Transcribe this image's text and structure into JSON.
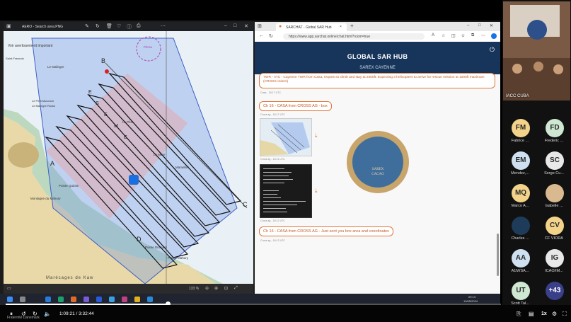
{
  "map_window": {
    "title": "AERO - Search area.PNG",
    "zoom": "133 %",
    "chart_labels": {
      "avertissement": "Voir avertissement important",
      "saint_francois": "Saint-Francois",
      "malingre": "Le Malingre",
      "petit_mouchoir": "Le Petit Mouchoir",
      "malingre_rocks": "Le Malingre Rocks",
      "pointe_quintin": "Pointe Quintin",
      "montagne": "Montagne du Mahury",
      "pointe_diamant": "Pointe Diamant",
      "marecages": "Marécages de Kaw",
      "letters": [
        "A",
        "B",
        "C",
        "D",
        "E",
        "S",
        "E",
        "M",
        "E"
      ],
      "perou": "Pérou",
      "pere": "Le Père",
      "mere": "La Mère",
      "mamelles": "Mamelles",
      "pointe_mahury": "Pointe Mahury"
    }
  },
  "browser": {
    "tab_title": "SARCHAT - Global SAR Hub",
    "url": "https://www.app.sarchat.online/chat.html?room=true"
  },
  "hub": {
    "title": "GLOBAL SAR HUB",
    "subtitle": "SAREX CAYENNE"
  },
  "chat": {
    "msg1_text": "TWR - ATC - Cayenne TWR from Casa, request to climb and stay at 2000ft. Expecting 3 helicopters to arrive for rescue mission at 1000ft maximum (CROSS orders)",
    "msg1_meta": "Casa - 18:17 UTC",
    "msg2_text": "Ch 16 - CASA from CROSS AG - box",
    "msg2_meta": "Cross ag - 18:17 UTC",
    "img1_meta": "Cross ag - 18:11 UTC",
    "img2_meta": "Cross ag - 18:12 UTC",
    "msg3_text": "Ch 16 - CASA from CROSS AG - Just sent you box area and coordinates",
    "msg3_meta": "Cross ag - 18:12 UTC",
    "emblem_line1": "SAREX",
    "emblem_line2": "CACAO"
  },
  "taskbar": {
    "time": "09:13",
    "date": "13/05/2024"
  },
  "video": {
    "time": "1:09:21 / 3:32:44",
    "speed": "1x",
    "progress_fraction": 0.327,
    "bottom_caption": "Fraternité Danemark"
  },
  "participants": {
    "room_label": "IACC CUBA",
    "people": [
      {
        "initials": "FM",
        "name": "Fabrice ...",
        "color": "#f3d38a"
      },
      {
        "initials": "FD",
        "name": "Frederic ...",
        "color": "#cfe8d2"
      },
      {
        "initials": "EM",
        "name": "Mendez,...",
        "color": "#cfe0f0"
      },
      {
        "initials": "SC",
        "name": "Serge Cu...",
        "color": "#e8e8e8"
      },
      {
        "initials": "MQ",
        "name": "Marco A...",
        "color": "#f3d38a"
      },
      {
        "initials": "",
        "name": "Isabelle ...",
        "color": "#d9b98f"
      },
      {
        "initials": "",
        "name": "Charles ...",
        "color": "#1f3b5a"
      },
      {
        "initials": "CV",
        "name": "CF VIORA",
        "color": "#f3d38a"
      },
      {
        "initials": "AA",
        "name": "A1M/SA...",
        "color": "#cfe0f0"
      },
      {
        "initials": "IG",
        "name": "ICAO/IM...",
        "color": "#e8e8e8"
      },
      {
        "initials": "UT",
        "name": "Scott Tal...",
        "color": "#cfe8d2"
      },
      {
        "initials": "+43",
        "name": "",
        "color": "#3a3f8a"
      }
    ]
  }
}
